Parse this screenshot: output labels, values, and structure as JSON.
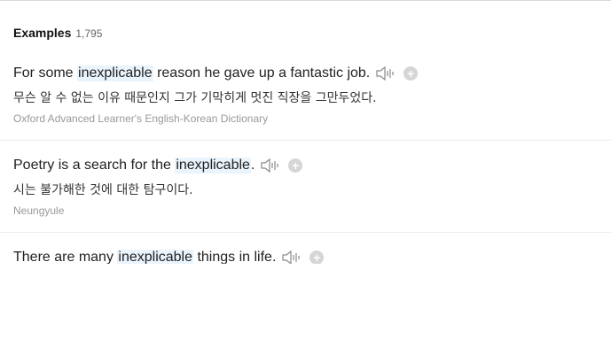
{
  "header": {
    "title": "Examples",
    "count": "1,795"
  },
  "examples": [
    {
      "before": "For some ",
      "highlight": "inexplicable",
      "after": " reason he gave up a fantastic job.",
      "translation": "무슨 알 수 없는 이유 때문인지 그가 기막히게 멋진 직장을 그만두었다.",
      "source": "Oxford Advanced Learner's English-Korean Dictionary"
    },
    {
      "before": "Poetry is a search for the ",
      "highlight": "inexplicable",
      "after": ".",
      "translation": "시는 불가해한 것에 대한 탐구이다.",
      "source": "Neungyule"
    },
    {
      "before": "There are many ",
      "highlight": "inexplicable",
      "after": " things in life.",
      "translation": "",
      "source": ""
    }
  ],
  "icons": {
    "speaker": "speaker-icon",
    "add": "add-icon"
  },
  "colors": {
    "highlight_bg": "#eaf4fd",
    "source_text": "#999999",
    "add_button": "#d6d6d6"
  }
}
